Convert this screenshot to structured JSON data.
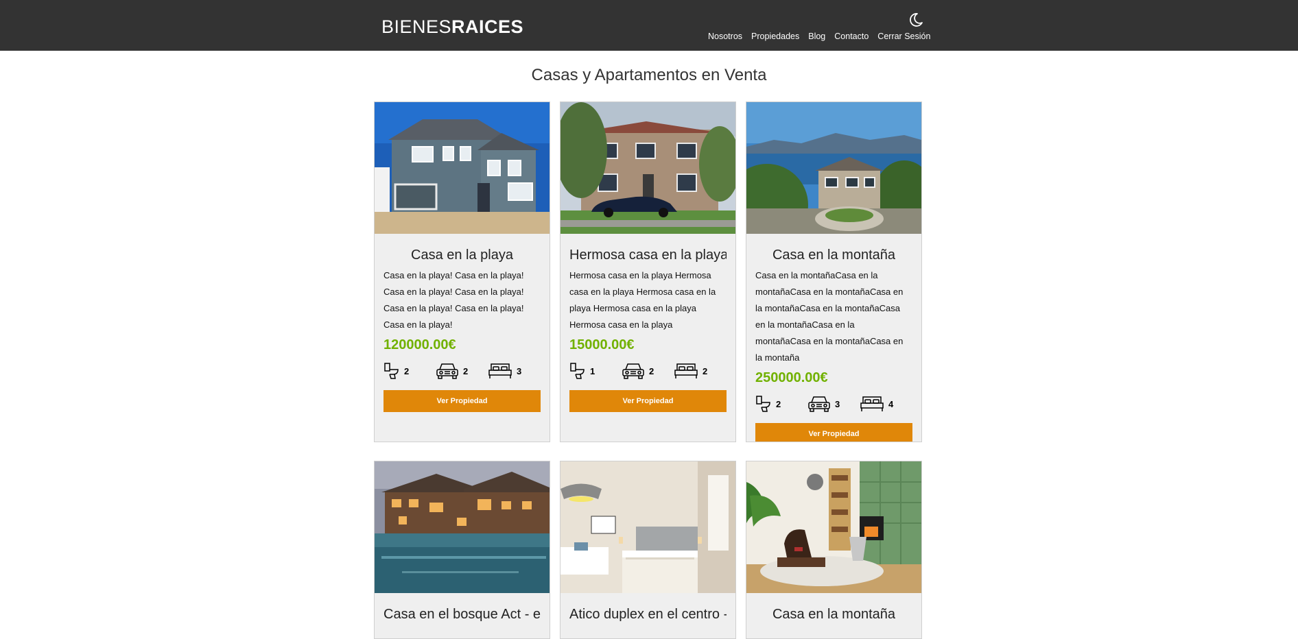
{
  "header": {
    "logo_light": "BIENES",
    "logo_bold": "RAICES",
    "dark_mode_icon": "moon-icon",
    "nav": [
      "Nosotros",
      "Propiedades",
      "Blog",
      "Contacto",
      "Cerrar Sesión"
    ]
  },
  "page_title": "Casas y Apartamentos en Venta",
  "colors": {
    "header_bg": "#333333",
    "price": "#71b100",
    "button": "#e08709",
    "card_bg": "#efefef"
  },
  "icons": {
    "bathroom": "toilet-icon",
    "parking": "car-icon",
    "bedrooms": "bed-icon"
  },
  "properties": [
    {
      "title": "Casa en la playa",
      "description": "Casa en la playa! Casa en la playa! Casa en la playa! Casa en la playa! Casa en la playa! Casa en la playa! Casa en la playa!",
      "price": "120000.00€",
      "baths": "2",
      "parking": "2",
      "rooms": "3",
      "button": "Ver Propiedad",
      "image": "two-story blue house photo"
    },
    {
      "title": "Hermosa casa en la playa",
      "description": "Hermosa casa en la playa Hermosa casa en la playa Hermosa casa en la playa Hermosa casa en la playa Hermosa casa en la playa",
      "price": "15000.00€",
      "baths": "1",
      "parking": "2",
      "rooms": "2",
      "button": "Ver Propiedad",
      "image": "brick house with car photo"
    },
    {
      "title": "Casa en la montaña",
      "description": "Casa en la montañaCasa en la montañaCasa en la montañaCasa en la montañaCasa en la montañaCasa en la montañaCasa en la montañaCasa en la montañaCasa en la montaña",
      "price": "250000.00€",
      "baths": "2",
      "parking": "3",
      "rooms": "4",
      "button": "Ver Propiedad",
      "image": "lake and mountain house photo"
    },
    {
      "title": "Casa en el bosque Act - en",
      "image": "lodge with pool photo"
    },
    {
      "title": "Atico duplex en el centro --",
      "image": "bedroom interior photo"
    },
    {
      "title": "Casa en la montaña",
      "image": "living room interior photo"
    }
  ]
}
